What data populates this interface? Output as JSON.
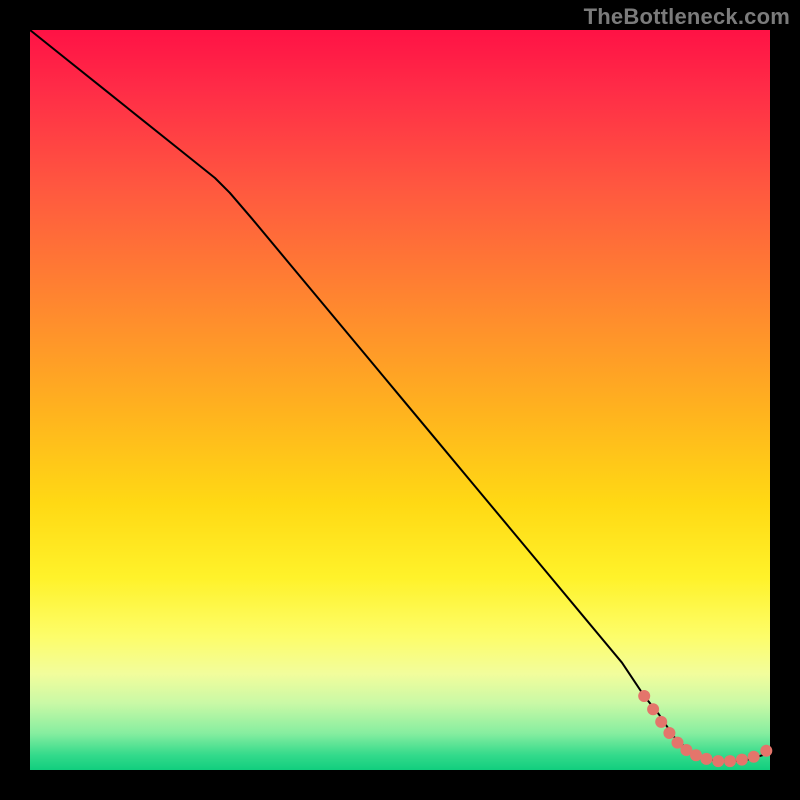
{
  "watermark": "TheBottleneck.com",
  "colors": {
    "frame": "#000000",
    "curve": "#000000",
    "marker": "#e4756b",
    "gradient_top": "#ff1245",
    "gradient_bottom": "#11ce7e"
  },
  "chart_data": {
    "type": "line",
    "title": "",
    "xlabel": "",
    "ylabel": "",
    "xlim": [
      0,
      100
    ],
    "ylim": [
      0,
      100
    ],
    "grid": false,
    "series": [
      {
        "name": "curve",
        "x": [
          0,
          5,
          10,
          15,
          20,
          25,
          27,
          30,
          35,
          40,
          45,
          50,
          55,
          60,
          65,
          70,
          75,
          80,
          83,
          85,
          87,
          89,
          91,
          93,
          95,
          97,
          99,
          100
        ],
        "y": [
          100,
          96,
          92,
          88,
          84,
          80,
          78,
          74.5,
          68.5,
          62.5,
          56.5,
          50.5,
          44.5,
          38.5,
          32.5,
          26.5,
          20.5,
          14.5,
          10,
          7.5,
          4.5,
          2.6,
          1.6,
          1.2,
          1.2,
          1.4,
          2.0,
          2.6
        ]
      }
    ],
    "markers": {
      "name": "highlight-points",
      "points": [
        {
          "x": 83.0,
          "y": 10.0
        },
        {
          "x": 84.2,
          "y": 8.2
        },
        {
          "x": 85.3,
          "y": 6.5
        },
        {
          "x": 86.4,
          "y": 5.0
        },
        {
          "x": 87.5,
          "y": 3.7
        },
        {
          "x": 88.7,
          "y": 2.7
        },
        {
          "x": 90.0,
          "y": 2.0
        },
        {
          "x": 91.4,
          "y": 1.5
        },
        {
          "x": 93.0,
          "y": 1.2
        },
        {
          "x": 94.6,
          "y": 1.2
        },
        {
          "x": 96.2,
          "y": 1.4
        },
        {
          "x": 97.8,
          "y": 1.8
        },
        {
          "x": 99.5,
          "y": 2.6
        }
      ]
    }
  }
}
